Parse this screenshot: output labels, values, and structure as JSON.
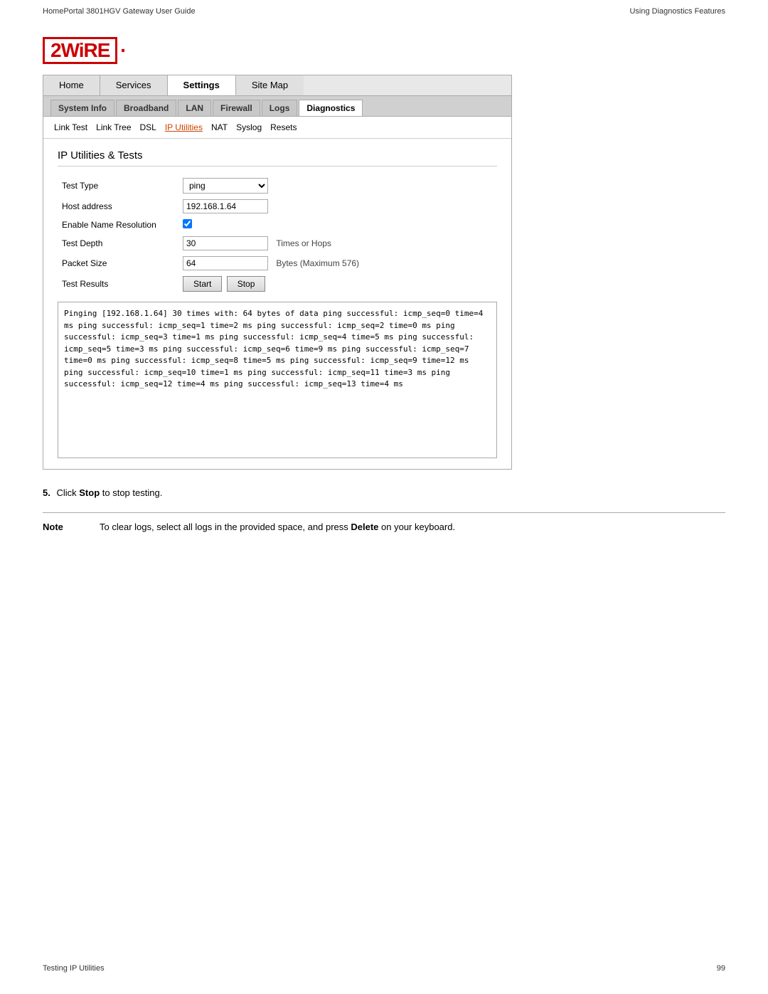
{
  "page": {
    "header_left": "HomePortal 3801HGV Gateway User Guide",
    "header_right": "Using Diagnostics Features",
    "footer_left": "Testing IP Utilities",
    "footer_right": "99"
  },
  "nav": {
    "outer_tabs": [
      {
        "label": "Home",
        "active": false
      },
      {
        "label": "Services",
        "active": false
      },
      {
        "label": "Settings",
        "active": true
      },
      {
        "label": "Site Map",
        "active": false
      }
    ],
    "inner_tabs": [
      {
        "label": "System Info",
        "active": false
      },
      {
        "label": "Broadband",
        "active": false
      },
      {
        "label": "LAN",
        "active": false
      },
      {
        "label": "Firewall",
        "active": false
      },
      {
        "label": "Logs",
        "active": false
      },
      {
        "label": "Diagnostics",
        "active": true
      }
    ],
    "sub_links": [
      {
        "label": "Link Test",
        "active": false
      },
      {
        "label": "Link Tree",
        "active": false
      },
      {
        "label": "DSL",
        "active": false
      },
      {
        "label": "IP Utilities",
        "active": true
      },
      {
        "label": "NAT",
        "active": false
      },
      {
        "label": "Syslog",
        "active": false
      },
      {
        "label": "Resets",
        "active": false
      }
    ]
  },
  "section": {
    "title": "IP Utilities & Tests",
    "fields": {
      "test_type_label": "Test Type",
      "test_type_value": "ping",
      "host_address_label": "Host address",
      "host_address_value": "192.168.1.64",
      "enable_name_resolution_label": "Enable Name Resolution",
      "enable_name_resolution_checked": true,
      "test_depth_label": "Test Depth",
      "test_depth_value": "30",
      "test_depth_hint": "Times or Hops",
      "packet_size_label": "Packet Size",
      "packet_size_value": "64",
      "packet_size_hint": "Bytes (Maximum 576)",
      "test_results_label": "Test Results"
    },
    "buttons": {
      "start": "Start",
      "stop": "Stop"
    },
    "results_header": "Pinging [192.168.1.64] 30 times with: 64 bytes of data",
    "results_lines": [
      "ping successful: icmp_seq=0 time=4 ms",
      "ping successful: icmp_seq=1 time=2 ms",
      "ping successful: icmp_seq=2 time=0 ms",
      "ping successful: icmp_seq=3 time=1 ms",
      "ping successful: icmp_seq=4 time=5 ms",
      "ping successful: icmp_seq=5 time=3 ms",
      "ping successful: icmp_seq=6 time=9 ms",
      "ping successful: icmp_seq=7 time=0 ms",
      "ping successful: icmp_seq=8 time=5 ms",
      "ping successful: icmp_seq=9 time=12 ms",
      "ping successful: icmp_seq=10 time=1 ms",
      "ping successful: icmp_seq=11 time=3 ms",
      "ping successful: icmp_seq=12 time=4 ms",
      "ping successful: icmp_seq=13 time=4 ms"
    ]
  },
  "instruction": {
    "step": "5.",
    "text_before": "Click ",
    "bold_word": "Stop",
    "text_after": " to stop testing."
  },
  "note": {
    "label": "Note",
    "text_before": "To clear logs, select all logs in the provided space, and press ",
    "bold_word": "Delete",
    "text_after": " on your keyboard."
  },
  "logo": {
    "text": "2WiRE"
  }
}
